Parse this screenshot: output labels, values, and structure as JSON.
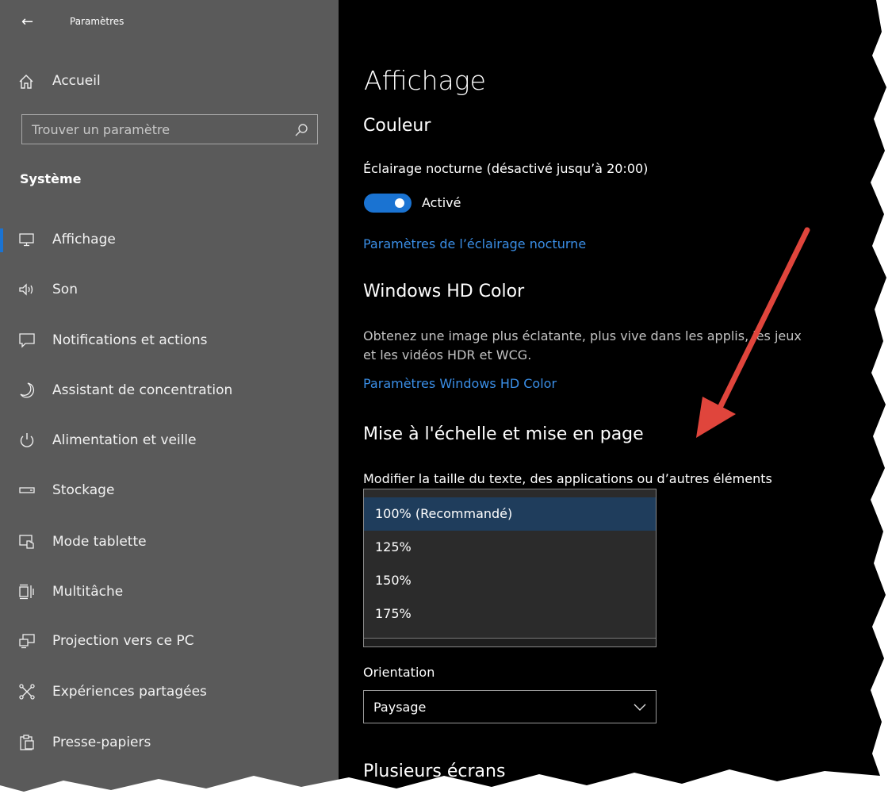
{
  "window": {
    "title": "Paramètres",
    "back_glyph": "←"
  },
  "sidebar": {
    "home_label": "Accueil",
    "search_placeholder": "Trouver un paramètre",
    "section_title": "Système",
    "items": [
      {
        "label": "Affichage",
        "icon": "monitor-icon",
        "selected": true
      },
      {
        "label": "Son",
        "icon": "speaker-icon"
      },
      {
        "label": "Notifications et actions",
        "icon": "notification-icon"
      },
      {
        "label": "Assistant de concentration",
        "icon": "moon-icon"
      },
      {
        "label": "Alimentation et veille",
        "icon": "power-icon"
      },
      {
        "label": "Stockage",
        "icon": "storage-icon"
      },
      {
        "label": "Mode tablette",
        "icon": "tablet-icon"
      },
      {
        "label": "Multitâche",
        "icon": "multitask-icon"
      },
      {
        "label": "Projection vers ce PC",
        "icon": "projection-icon"
      },
      {
        "label": "Expériences partagées",
        "icon": "shared-icon"
      },
      {
        "label": "Presse-papiers",
        "icon": "clipboard-icon"
      }
    ]
  },
  "main": {
    "page_title": "Affichage",
    "color": {
      "heading": "Couleur",
      "night_light_label": "Éclairage nocturne (désactivé jusqu’à 20:00)",
      "toggle_state": "Activé",
      "night_light_link": "Paramètres de l’éclairage nocturne"
    },
    "hdr": {
      "heading": "Windows HD Color",
      "description_line1": "Obtenez une image plus éclatante, plus vive dans les applis, les jeux",
      "description_line2": "et les vidéos HDR et WCG.",
      "link": "Paramètres Windows HD Color"
    },
    "scale": {
      "heading": "Mise à l'échelle et mise en page",
      "label": "Modifier la taille du texte, des applications ou d’autres éléments",
      "options": [
        "100% (Recommandé)",
        "125%",
        "150%",
        "175%"
      ],
      "selected_index": 0
    },
    "orientation": {
      "label": "Orientation",
      "value": "Paysage"
    },
    "multi_screens_heading": "Plusieurs écrans"
  },
  "colors": {
    "accent": "#1a73d2",
    "link": "#3a8ee6",
    "arrow": "#e0453c",
    "sidebar_bg": "#5a5a5a",
    "main_bg": "#000000"
  }
}
